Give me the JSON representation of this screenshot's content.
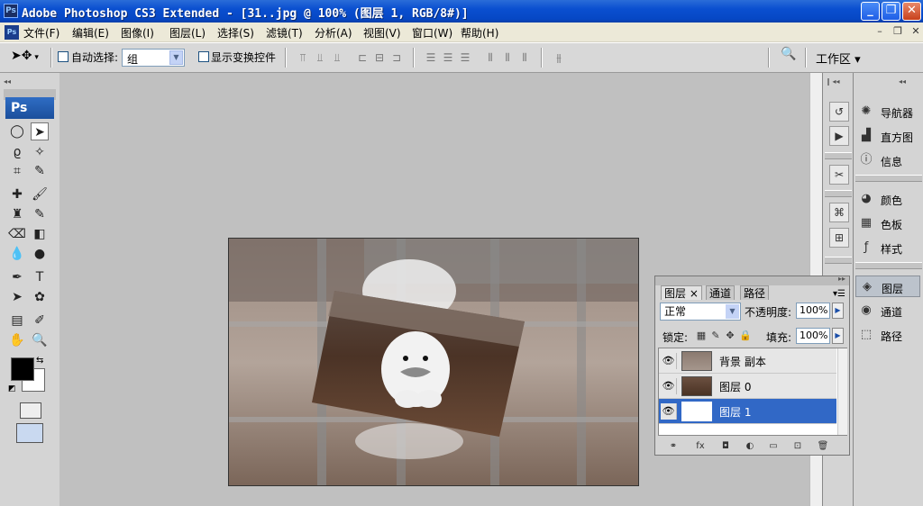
{
  "window": {
    "title": "Adobe Photoshop CS3 Extended - [31..jpg @ 100% (图层 1, RGB/8#)]",
    "app_icon": "Ps"
  },
  "menubar": {
    "doc_icon": "Ps",
    "items": [
      "文件(F)",
      "编辑(E)",
      "图像(I)",
      "图层(L)",
      "选择(S)",
      "滤镜(T)",
      "分析(A)",
      "视图(V)",
      "窗口(W)",
      "帮助(H)"
    ]
  },
  "options_bar": {
    "auto_select_label": "自动选择:",
    "auto_select_value": "组",
    "show_transform_label": "显示变换控件",
    "workspace_label": "工作区 ▾"
  },
  "tools": {
    "logo": "Ps",
    "active_tool": "move-tool"
  },
  "dock": {
    "items": [
      {
        "label": "导航器",
        "icon": "navigator-icon"
      },
      {
        "label": "直方图",
        "icon": "histogram-icon"
      },
      {
        "label": "信息",
        "icon": "info-icon"
      },
      {
        "label": "颜色",
        "icon": "color-icon"
      },
      {
        "label": "色板",
        "icon": "swatches-icon"
      },
      {
        "label": "样式",
        "icon": "styles-icon"
      },
      {
        "label": "图层",
        "icon": "layers-icon"
      },
      {
        "label": "通道",
        "icon": "channels-icon"
      },
      {
        "label": "路径",
        "icon": "paths-icon"
      }
    ]
  },
  "layers_panel": {
    "tabs": [
      "图层 ×",
      "通道",
      "路径"
    ],
    "blend_mode": "正常",
    "opacity_label": "不透明度:",
    "opacity_value": "100%",
    "lock_label": "锁定:",
    "fill_label": "填充:",
    "fill_value": "100%",
    "layers": [
      {
        "name": "背景 副本",
        "visible": true,
        "selected": false
      },
      {
        "name": "图层 0",
        "visible": true,
        "selected": false
      },
      {
        "name": "图层 1",
        "visible": true,
        "selected": true
      }
    ]
  },
  "colors": {
    "title_bar": "#0a4fd0",
    "selection": "#3168c6",
    "foreground": "#000000",
    "background": "#ffffff"
  }
}
